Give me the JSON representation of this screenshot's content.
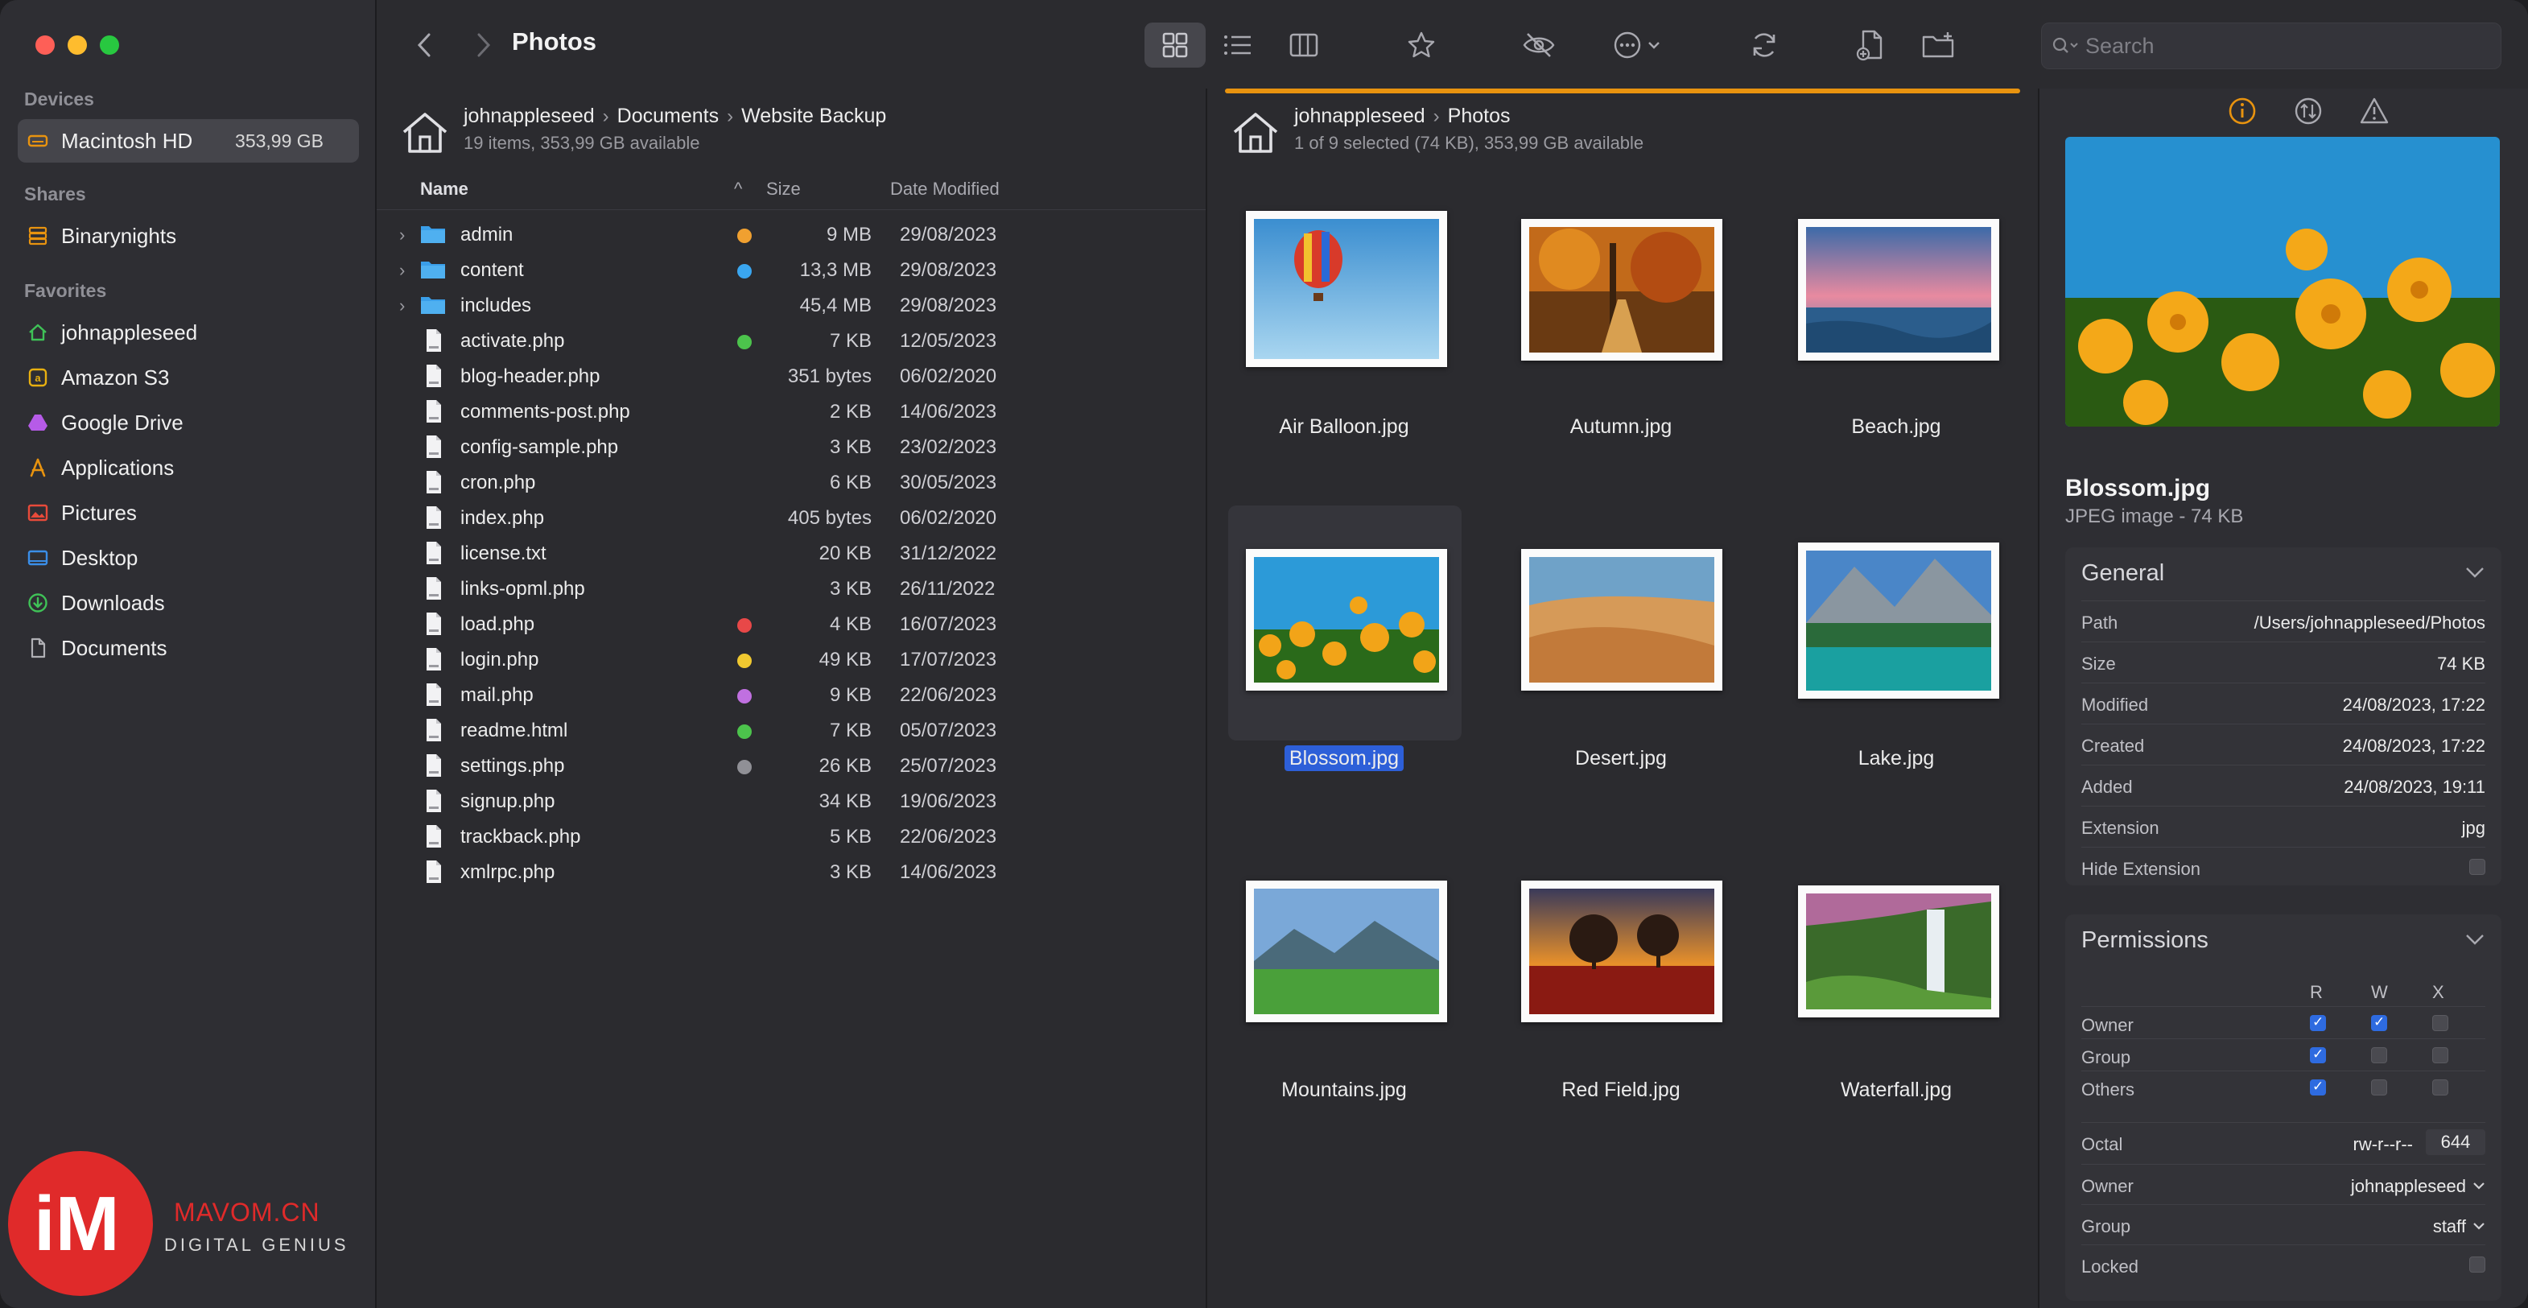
{
  "sidebar": {
    "sections": {
      "devices": "Devices",
      "shares": "Shares",
      "favorites": "Favorites"
    },
    "devices": [
      {
        "label": "Macintosh HD",
        "capacity": "353,99 GB",
        "icon": "drive-icon",
        "color": "#e8930f"
      }
    ],
    "shares": [
      {
        "label": "Binarynights",
        "icon": "server-icon",
        "color": "#e8930f"
      }
    ],
    "favorites": [
      {
        "label": "johnappleseed",
        "icon": "home-icon",
        "color": "#3fc257"
      },
      {
        "label": "Amazon S3",
        "icon": "amazon-s3-icon",
        "color": "#e8b010"
      },
      {
        "label": "Google Drive",
        "icon": "google-drive-icon",
        "color": "#b65be8"
      },
      {
        "label": "Applications",
        "icon": "applications-icon",
        "color": "#e8930f"
      },
      {
        "label": "Pictures",
        "icon": "pictures-icon",
        "color": "#e84a3a"
      },
      {
        "label": "Desktop",
        "icon": "desktop-icon",
        "color": "#3a8ee8"
      },
      {
        "label": "Downloads",
        "icon": "downloads-icon",
        "color": "#3fc257"
      },
      {
        "label": "Documents",
        "icon": "documents-icon",
        "color": "#b0b0b5"
      }
    ]
  },
  "toolbar": {
    "title": "Photos",
    "search_placeholder": "Search"
  },
  "left_pane": {
    "breadcrumb": [
      "johnappleseed",
      "Documents",
      "Website  Backup"
    ],
    "info": "19 items, 353,99 GB available",
    "columns": {
      "name": "Name",
      "size": "Size",
      "date": "Date Modified"
    },
    "rows": [
      {
        "name": "admin",
        "folder": true,
        "tag": "#f0a030",
        "size": "9 MB",
        "date": "29/08/2023"
      },
      {
        "name": "content",
        "folder": true,
        "tag": "#3aa6f0",
        "size": "13,3 MB",
        "date": "29/08/2023"
      },
      {
        "name": "includes",
        "folder": true,
        "tag": "",
        "size": "45,4 MB",
        "date": "29/08/2023"
      },
      {
        "name": "activate.php",
        "folder": false,
        "tag": "#4cc34c",
        "size": "7 KB",
        "date": "12/05/2023"
      },
      {
        "name": "blog-header.php",
        "folder": false,
        "tag": "",
        "size": "351 bytes",
        "date": "06/02/2020"
      },
      {
        "name": "comments-post.php",
        "folder": false,
        "tag": "",
        "size": "2 KB",
        "date": "14/06/2023"
      },
      {
        "name": "config-sample.php",
        "folder": false,
        "tag": "",
        "size": "3 KB",
        "date": "23/02/2023"
      },
      {
        "name": "cron.php",
        "folder": false,
        "tag": "",
        "size": "6 KB",
        "date": "30/05/2023"
      },
      {
        "name": "index.php",
        "folder": false,
        "tag": "",
        "size": "405 bytes",
        "date": "06/02/2020"
      },
      {
        "name": "license.txt",
        "folder": false,
        "tag": "",
        "size": "20 KB",
        "date": "31/12/2022"
      },
      {
        "name": "links-opml.php",
        "folder": false,
        "tag": "",
        "size": "3 KB",
        "date": "26/11/2022"
      },
      {
        "name": "load.php",
        "folder": false,
        "tag": "#e84848",
        "size": "4 KB",
        "date": "16/07/2023"
      },
      {
        "name": "login.php",
        "folder": false,
        "tag": "#f0c830",
        "size": "49 KB",
        "date": "17/07/2023"
      },
      {
        "name": "mail.php",
        "folder": false,
        "tag": "#c070e0",
        "size": "9 KB",
        "date": "22/06/2023"
      },
      {
        "name": "readme.html",
        "folder": false,
        "tag": "#4cc34c",
        "size": "7 KB",
        "date": "05/07/2023"
      },
      {
        "name": "settings.php",
        "folder": false,
        "tag": "#909096",
        "size": "26 KB",
        "date": "25/07/2023"
      },
      {
        "name": "signup.php",
        "folder": false,
        "tag": "",
        "size": "34 KB",
        "date": "19/06/2023"
      },
      {
        "name": "trackback.php",
        "folder": false,
        "tag": "",
        "size": "5 KB",
        "date": "22/06/2023"
      },
      {
        "name": "xmlrpc.php",
        "folder": false,
        "tag": "",
        "size": "3 KB",
        "date": "14/06/2023"
      }
    ]
  },
  "middle_pane": {
    "breadcrumb": [
      "johnappleseed",
      "Photos"
    ],
    "info": "1 of 9 selected (74 KB), 353,99 GB available",
    "items": [
      {
        "label": "Air Balloon.jpg",
        "selected": false
      },
      {
        "label": "Autumn.jpg",
        "selected": false
      },
      {
        "label": "Beach.jpg",
        "selected": false
      },
      {
        "label": "Blossom.jpg",
        "selected": true
      },
      {
        "label": "Desert.jpg",
        "selected": false
      },
      {
        "label": "Lake.jpg",
        "selected": false
      },
      {
        "label": "Mountains.jpg",
        "selected": false
      },
      {
        "label": "Red Field.jpg",
        "selected": false
      },
      {
        "label": "Waterfall.jpg",
        "selected": false
      }
    ]
  },
  "inspector": {
    "file_name": "Blossom.jpg",
    "file_type": "JPEG image - 74 KB",
    "general": {
      "title": "General",
      "rows": [
        {
          "k": "Path",
          "v": "/Users/johnappleseed/Photos"
        },
        {
          "k": "Size",
          "v": "74 KB"
        },
        {
          "k": "Modified",
          "v": "24/08/2023, 17:22"
        },
        {
          "k": "Created",
          "v": "24/08/2023, 17:22"
        },
        {
          "k": "Added",
          "v": "24/08/2023, 19:11"
        },
        {
          "k": "Extension",
          "v": "jpg"
        },
        {
          "k": "Hide Extension",
          "v": ""
        }
      ]
    },
    "permissions": {
      "title": "Permissions",
      "cols": [
        "R",
        "W",
        "X"
      ],
      "rows": [
        {
          "k": "Owner",
          "r": true,
          "w": true,
          "x": false
        },
        {
          "k": "Group",
          "r": true,
          "w": false,
          "x": false
        },
        {
          "k": "Others",
          "r": true,
          "w": false,
          "x": false
        }
      ],
      "octal_label": "Octal",
      "octal_string": "rw-r--r--",
      "octal_value": "644",
      "owner_label": "Owner",
      "owner_value": "johnappleseed",
      "group_label": "Group",
      "group_value": "staff",
      "locked_label": "Locked"
    }
  },
  "watermark": {
    "brand": "MAVOM.CN",
    "tagline": "DIGITAL GENIUS",
    "logo_text": "iM"
  },
  "colors": {
    "accent": "#e8930f",
    "selection": "#2d5fd8",
    "window_bg": "#2b2b2f"
  }
}
